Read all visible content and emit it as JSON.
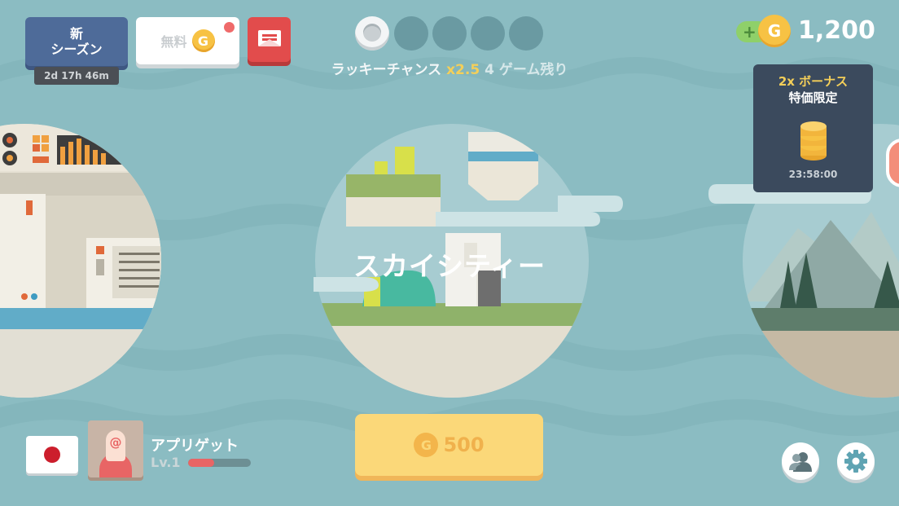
{
  "top_left": {
    "season_label_line1": "新",
    "season_label_line2": "シーズン",
    "season_timer": "2d 17h 46m",
    "free_label": "無料",
    "free_coin_letter": "G"
  },
  "lucky_chance": {
    "label": "ラッキーチャンス",
    "multiplier": "x2.5",
    "games_left": "4 ゲーム残り",
    "total_slots": 5,
    "filled_slots": 1
  },
  "currency": {
    "plus_label": "+",
    "coin_letter": "G",
    "amount": "1,200"
  },
  "bonus_card": {
    "title": "2x ボーナス",
    "subtitle": "特価限定",
    "timer": "23:58:00"
  },
  "world": {
    "name": "スカイシティー"
  },
  "player": {
    "name": "アプリゲット",
    "level": "Lv.1",
    "xp_fraction": 0.42,
    "avatar_letter": "@"
  },
  "play_button": {
    "coin_letter": "G",
    "cost": "500"
  },
  "colors": {
    "background": "#8bbcc2",
    "season_button": "#4e6b99",
    "mail_button": "#e24c4c",
    "play_button": "#fbd879",
    "bonus_card": "#3b4a5d",
    "accent_gold": "#f4cf59"
  },
  "icons": {
    "mail": "mail-icon",
    "friends": "friends-icon",
    "settings": "gear-icon",
    "flag": "japan-flag-icon"
  }
}
